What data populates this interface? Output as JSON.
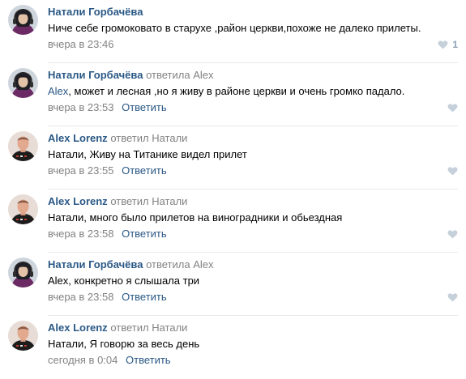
{
  "comments": [
    {
      "author": "Натали Горбачёва",
      "reply_word": "",
      "reply_target": "",
      "mention": "",
      "text": "Ниче себе громоковато в старухе ,район церкви,похоже не далеко прилеты.",
      "date": "вчера в 23:46",
      "reply_label": "",
      "likes": "1",
      "avatar_icon": "woman-with-headphones-avatar"
    },
    {
      "author": "Натали Горбачёва",
      "reply_word": "ответила",
      "reply_target": "Alex",
      "mention": "Alex",
      "text": ", может и лесная ,но я живу в районе церкви и очень громко падало.",
      "date": "вчера в 23:53",
      "reply_label": "Ответить",
      "likes": "",
      "avatar_icon": "woman-with-headphones-avatar"
    },
    {
      "author": "Alex Lorenz",
      "reply_word": "ответил",
      "reply_target": "Натали",
      "mention": "",
      "text": "Натали, Живу на Титанике видел прилет",
      "date": "вчера в 23:55",
      "reply_label": "Ответить",
      "likes": "",
      "avatar_icon": "man-in-black-shirt-avatar"
    },
    {
      "author": "Alex Lorenz",
      "reply_word": "ответил",
      "reply_target": "Натали",
      "mention": "",
      "text": "Натали, много было прилетов на виноградники и обьездная",
      "date": "вчера в 23:58",
      "reply_label": "Ответить",
      "likes": "",
      "avatar_icon": "man-in-black-shirt-avatar"
    },
    {
      "author": "Натали Горбачёва",
      "reply_word": "ответила",
      "reply_target": "Alex",
      "mention": "",
      "text": "Alex, конкретно я слышала три",
      "date": "вчера в 23:58",
      "reply_label": "Ответить",
      "likes": "",
      "avatar_icon": "woman-with-headphones-avatar"
    },
    {
      "author": "Alex Lorenz",
      "reply_word": "ответил",
      "reply_target": "Натали",
      "mention": "",
      "text": "Натали, Я говорю за весь день",
      "date": "сегодня в 0:04",
      "reply_label": "Ответить",
      "likes": "",
      "avatar_icon": "man-in-black-shirt-avatar"
    }
  ],
  "colors": {
    "link": "#2a5885",
    "muted": "#828282",
    "like_heart": "#c5d0db",
    "like_count": "#8fa1b4"
  }
}
